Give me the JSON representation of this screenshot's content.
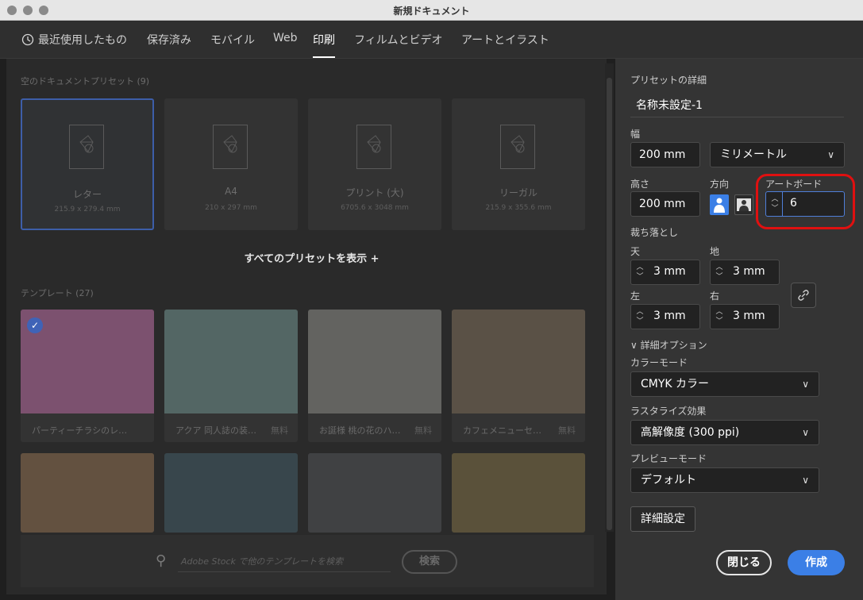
{
  "window": {
    "title": "新規ドキュメント"
  },
  "tabs": [
    {
      "label": "最近使用したもの",
      "icon": "clock-icon"
    },
    {
      "label": "保存済み"
    },
    {
      "label": "モバイル"
    },
    {
      "label": "Web"
    },
    {
      "label": "印刷",
      "active": true
    },
    {
      "label": "フィルムとビデオ"
    },
    {
      "label": "アートとイラスト"
    }
  ],
  "presets": {
    "section_title": "空のドキュメントプリセット (9)",
    "items": [
      {
        "name": "レター",
        "size": "215.9 x 279.4 mm",
        "selected": true
      },
      {
        "name": "A4",
        "size": "210 x 297 mm"
      },
      {
        "name": "プリント (大)",
        "size": "6705.6 x 3048 mm"
      },
      {
        "name": "リーガル",
        "size": "215.9 x 355.6 mm"
      }
    ],
    "show_all": "すべてのプリセットを表示 +"
  },
  "templates": {
    "section_title": "テンプレート (27)",
    "items": [
      {
        "caption": "パーティーチラシのレ…",
        "free": "",
        "color": "#b86aa0",
        "checked": true
      },
      {
        "caption": "アクア 同人誌の装…",
        "free": "無料",
        "color": "#6d8f8c"
      },
      {
        "caption": "お誕様 桃の花のハ…",
        "free": "無料",
        "color": "#8b8a85"
      },
      {
        "caption": "カフェメニューセ…",
        "free": "無料",
        "color": "#7a6a55"
      },
      {
        "caption": "",
        "free": "",
        "color": "#8a6a4a"
      },
      {
        "caption": "",
        "free": "",
        "color": "#3c5560"
      },
      {
        "caption": "",
        "free": "",
        "color": "#4a4d50"
      },
      {
        "caption": "",
        "free": "",
        "color": "#7a6a40"
      }
    ]
  },
  "search": {
    "placeholder": "Adobe Stock で他のテンプレートを検索",
    "button": "検索"
  },
  "details": {
    "title": "プリセットの詳細",
    "doc_name": "名称未設定-1",
    "width_label": "幅",
    "width": "200 mm",
    "unit": "ミリメートル",
    "height_label": "高さ",
    "height": "200 mm",
    "orientation_label": "方向",
    "artboard_label": "アートボード",
    "artboard_value": "6",
    "bleed_label": "裁ち落とし",
    "bleed": {
      "top_label": "天",
      "top": "3 mm",
      "bottom_label": "地",
      "bottom": "3 mm",
      "left_label": "左",
      "left": "3 mm",
      "right_label": "右",
      "right": "3 mm"
    },
    "advanced_toggle": "詳細オプション",
    "color_mode_label": "カラーモード",
    "color_mode": "CMYK カラー",
    "raster_label": "ラスタライズ効果",
    "raster": "高解像度 (300 ppi)",
    "preview_label": "プレビューモード",
    "preview": "デフォルト",
    "more_settings": "詳細設定",
    "close": "閉じる",
    "create": "作成"
  },
  "colors": {
    "accent": "#3b7fe6",
    "highlight": "#e01010"
  }
}
